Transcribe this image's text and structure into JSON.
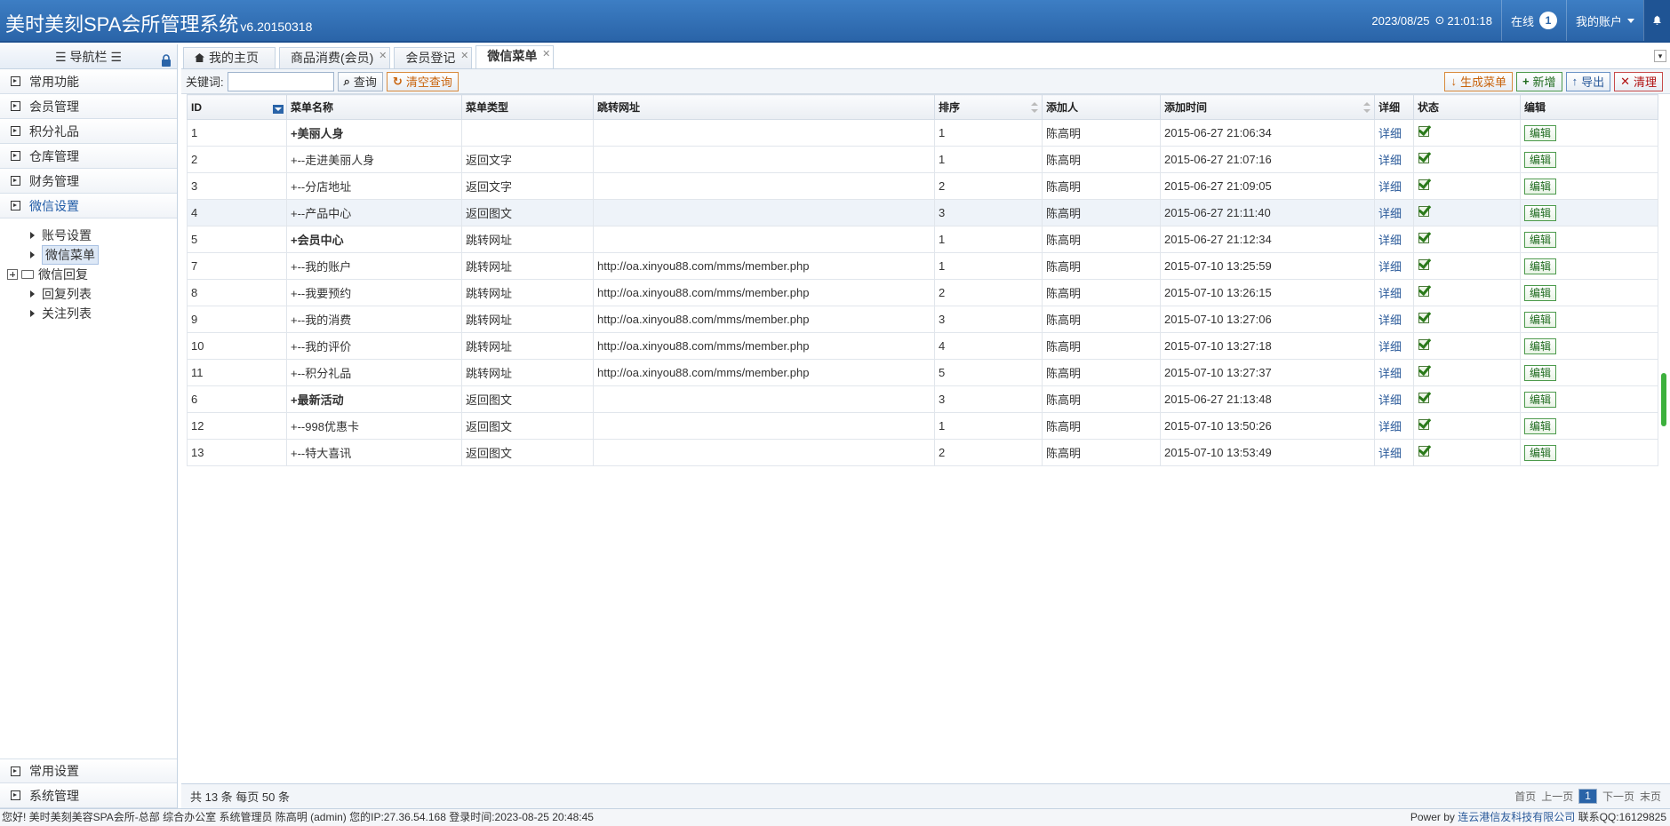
{
  "header": {
    "title": "美时美刻SPA会所管理系统",
    "version": "v6.20150318",
    "date": "2023/08/25",
    "time": "21:01:18",
    "online_label": "在线",
    "online_count": "1",
    "account_label": "我的账户"
  },
  "sidebar": {
    "nav_title": "☰ 导航栏 ☰",
    "items": [
      {
        "label": "常用功能"
      },
      {
        "label": "会员管理"
      },
      {
        "label": "积分礼品"
      },
      {
        "label": "仓库管理"
      },
      {
        "label": "财务管理"
      },
      {
        "label": "微信设置"
      }
    ],
    "tree": [
      {
        "label": "账号设置"
      },
      {
        "label": "微信菜单"
      },
      {
        "label": "微信回复"
      },
      {
        "label": "回复列表"
      },
      {
        "label": "关注列表"
      }
    ],
    "bottom_items": [
      {
        "label": "常用设置"
      },
      {
        "label": "系统管理"
      }
    ]
  },
  "tabs": [
    {
      "label": "我的主页"
    },
    {
      "label": "商品消费(会员)"
    },
    {
      "label": "会员登记"
    },
    {
      "label": "微信菜单"
    }
  ],
  "toolbar": {
    "keyword_label": "关键词:",
    "keyword_value": "",
    "search_label": "查询",
    "clear_label": "清空查询",
    "generate_label": "生成菜单",
    "add_label": "新增",
    "export_label": "导出",
    "purge_label": "清理"
  },
  "table": {
    "columns": [
      "ID",
      "菜单名称",
      "菜单类型",
      "跳转网址",
      "排序",
      "添加人",
      "添加时间",
      "详细",
      "状态",
      "编辑"
    ],
    "rows": [
      {
        "id": "1",
        "name": "+美丽人身",
        "type": "",
        "url": "",
        "order": "1",
        "user": "陈高明",
        "time": "2015-06-27 21:06:34",
        "detail": "详细",
        "edit": "编辑"
      },
      {
        "id": "2",
        "name": "+--走进美丽人身",
        "type": "返回文字",
        "url": "",
        "order": "1",
        "user": "陈高明",
        "time": "2015-06-27 21:07:16",
        "detail": "详细",
        "edit": "编辑"
      },
      {
        "id": "3",
        "name": "+--分店地址",
        "type": "返回文字",
        "url": "",
        "order": "2",
        "user": "陈高明",
        "time": "2015-06-27 21:09:05",
        "detail": "详细",
        "edit": "编辑"
      },
      {
        "id": "4",
        "name": "+--产品中心",
        "type": "返回图文",
        "url": "",
        "order": "3",
        "user": "陈高明",
        "time": "2015-06-27 21:11:40",
        "detail": "详细",
        "edit": "编辑"
      },
      {
        "id": "5",
        "name": "+会员中心",
        "type": "跳转网址",
        "url": "",
        "order": "1",
        "user": "陈高明",
        "time": "2015-06-27 21:12:34",
        "detail": "详细",
        "edit": "编辑"
      },
      {
        "id": "7",
        "name": "+--我的账户",
        "type": "跳转网址",
        "url": "http://oa.xinyou88.com/mms/member.php",
        "order": "1",
        "user": "陈高明",
        "time": "2015-07-10 13:25:59",
        "detail": "详细",
        "edit": "编辑"
      },
      {
        "id": "8",
        "name": "+--我要预约",
        "type": "跳转网址",
        "url": "http://oa.xinyou88.com/mms/member.php",
        "order": "2",
        "user": "陈高明",
        "time": "2015-07-10 13:26:15",
        "detail": "详细",
        "edit": "编辑"
      },
      {
        "id": "9",
        "name": "+--我的消费",
        "type": "跳转网址",
        "url": "http://oa.xinyou88.com/mms/member.php",
        "order": "3",
        "user": "陈高明",
        "time": "2015-07-10 13:27:06",
        "detail": "详细",
        "edit": "编辑"
      },
      {
        "id": "10",
        "name": "+--我的评价",
        "type": "跳转网址",
        "url": "http://oa.xinyou88.com/mms/member.php",
        "order": "4",
        "user": "陈高明",
        "time": "2015-07-10 13:27:18",
        "detail": "详细",
        "edit": "编辑"
      },
      {
        "id": "11",
        "name": "+--积分礼品",
        "type": "跳转网址",
        "url": "http://oa.xinyou88.com/mms/member.php",
        "order": "5",
        "user": "陈高明",
        "time": "2015-07-10 13:27:37",
        "detail": "详细",
        "edit": "编辑"
      },
      {
        "id": "6",
        "name": "+最新活动",
        "type": "返回图文",
        "url": "",
        "order": "3",
        "user": "陈高明",
        "time": "2015-06-27 21:13:48",
        "detail": "详细",
        "edit": "编辑"
      },
      {
        "id": "12",
        "name": "+--998优惠卡",
        "type": "返回图文",
        "url": "",
        "order": "1",
        "user": "陈高明",
        "time": "2015-07-10 13:50:26",
        "detail": "详细",
        "edit": "编辑"
      },
      {
        "id": "13",
        "name": "+--特大喜讯",
        "type": "返回图文",
        "url": "",
        "order": "2",
        "user": "陈高明",
        "time": "2015-07-10 13:53:49",
        "detail": "详细",
        "edit": "编辑"
      }
    ]
  },
  "pager": {
    "summary": "共 13 条 每页 50 条",
    "first": "首页",
    "prev": "上一页",
    "page": "1",
    "next": "下一页",
    "last": "末页"
  },
  "statusbar": {
    "left": "您好! 美时美刻美容SPA会所-总部 综合办公室 系统管理员 陈高明 (admin) 您的IP:27.36.54.168 登录时间:2023-08-25 20:48:45",
    "power": "Power by",
    "company": "连云港信友科技有限公司",
    "contact": "联系QQ:16129825"
  },
  "colors": {
    "header": "#2a64a8",
    "link": "#2a5a9a",
    "edit_green": "#1f6b1f"
  }
}
